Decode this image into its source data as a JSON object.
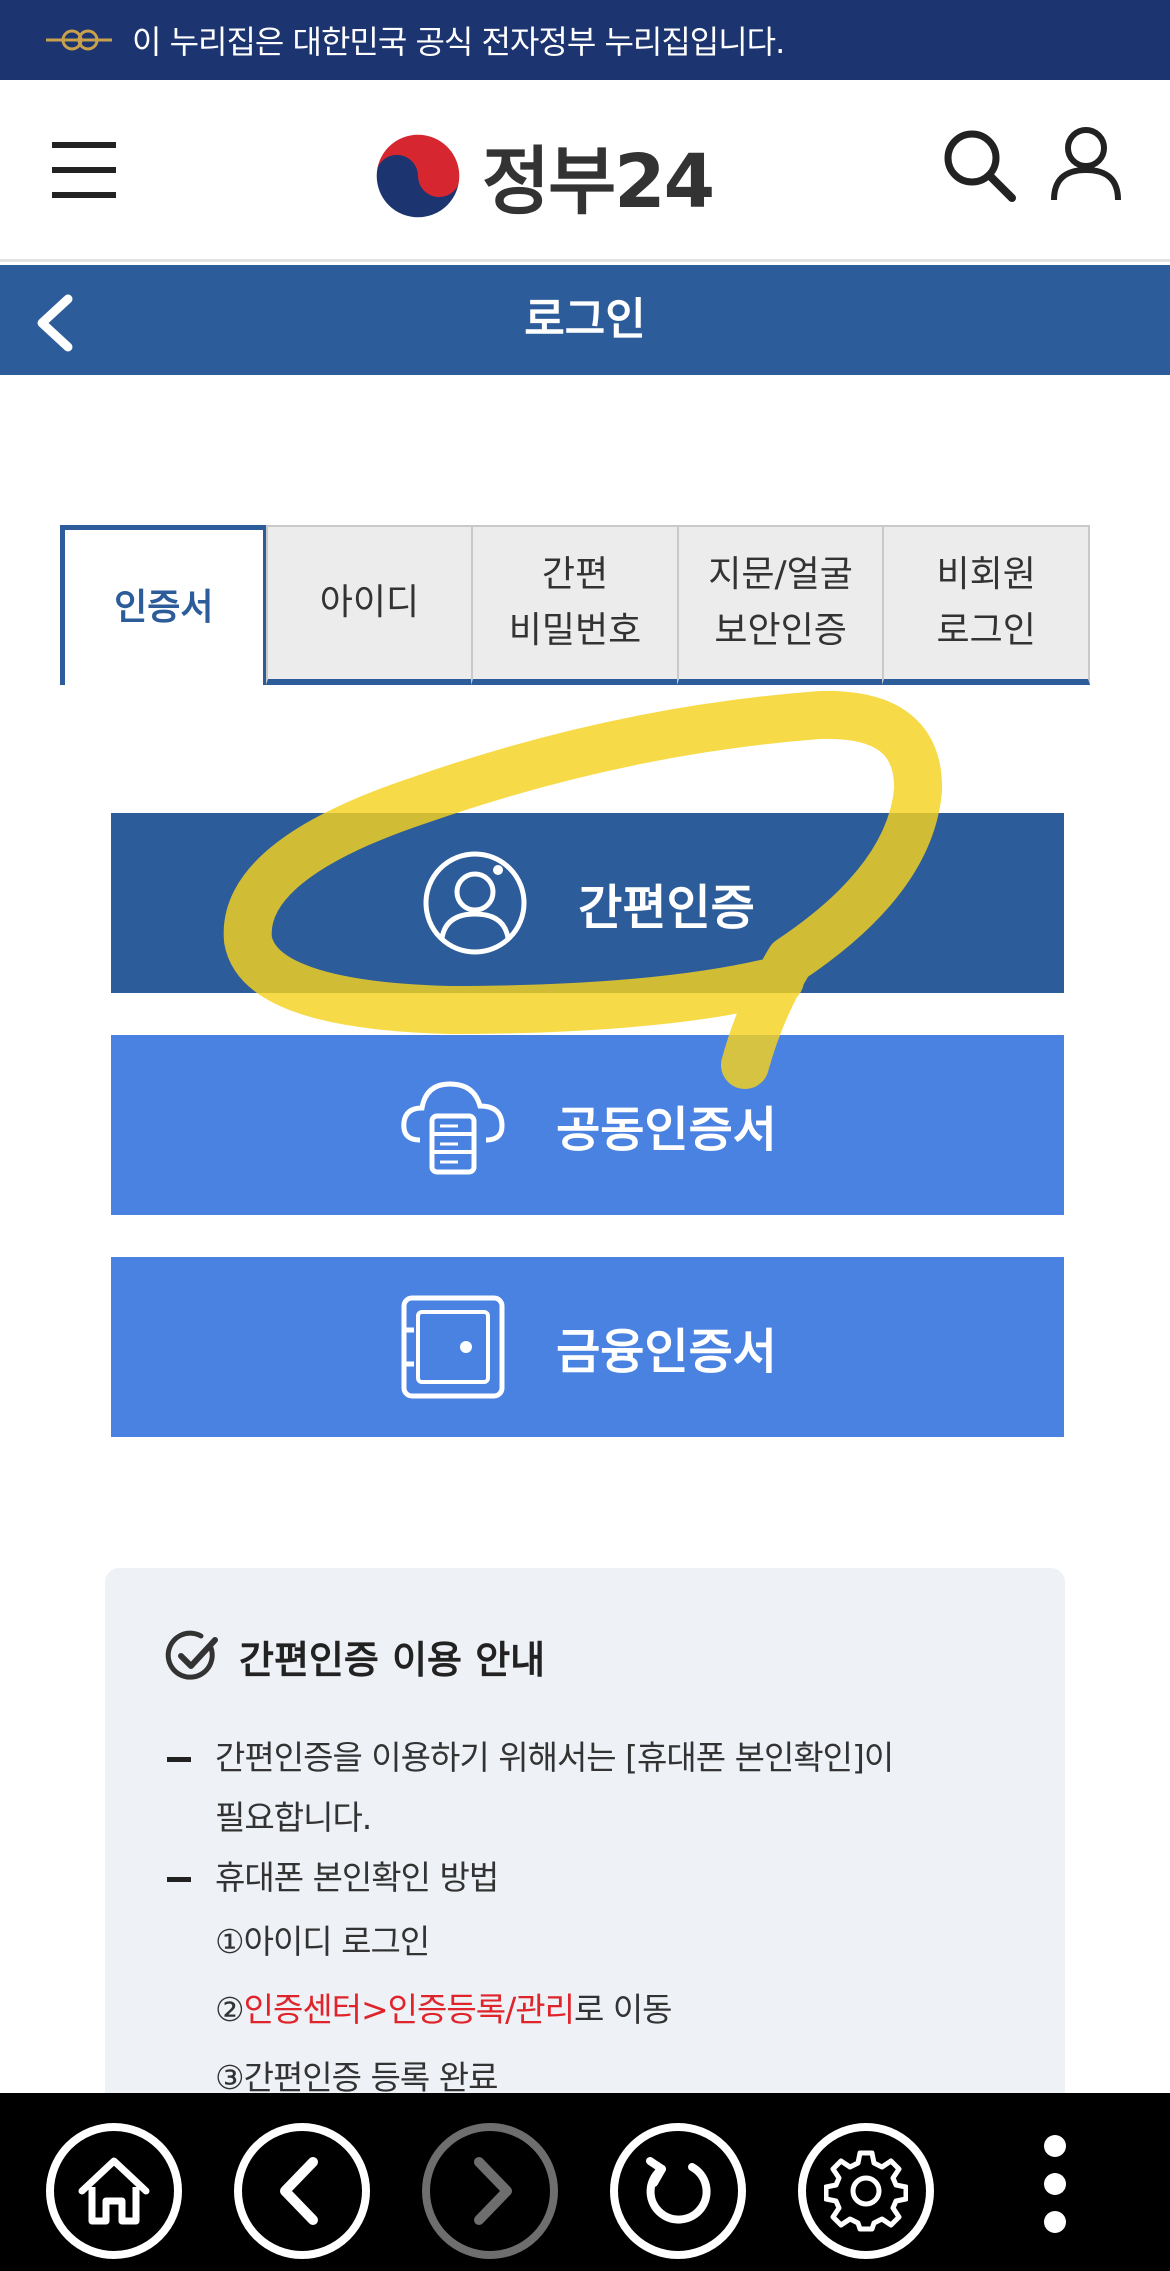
{
  "banner": {
    "text": "이 누리집은 대한민국 공식 전자정부 누리집입니다."
  },
  "header": {
    "logo_text": "정부24"
  },
  "titlebar": {
    "title": "로그인"
  },
  "tabs": [
    {
      "line1": "인증서",
      "line2": "",
      "active": true
    },
    {
      "line1": "아이디",
      "line2": "",
      "active": false
    },
    {
      "line1": "간편",
      "line2": "비밀번호",
      "active": false
    },
    {
      "line1": "지문/얼굴",
      "line2": "보안인증",
      "active": false
    },
    {
      "line1": "비회원",
      "line2": "로그인",
      "active": false
    }
  ],
  "auth_buttons": {
    "simple": "간편인증",
    "joint": "공동인증서",
    "finance": "금융인증서"
  },
  "info": {
    "title": "간편인증 이용 안내",
    "item1_line1": "간편인증을 이용하기 위해서는 [휴대폰 본인확인]이",
    "item1_line2": "필요합니다.",
    "item2": "휴대폰 본인확인 방법",
    "step1": "①아이디 로그인",
    "step2_num": "②",
    "step2_red": "인증센터>인증등록/관리",
    "step2_tail": "로 이동",
    "step3": "③간편인증 등록 완료"
  },
  "colors": {
    "banner": "#1c3570",
    "primary": "#2c5c9a",
    "secondary_button": "#4a82e2",
    "info_bg": "#eef1f6",
    "highlight": "#f5d21e",
    "link_red": "#e0242b"
  },
  "icons": {
    "menu": "hamburger-icon",
    "search": "search-icon",
    "user": "user-icon",
    "back": "chevron-left-icon",
    "simple": "person-circle-icon",
    "joint": "cloud-server-icon",
    "finance": "safe-icon",
    "check": "check-circle-icon",
    "home": "home-icon",
    "prev": "arrow-left-icon",
    "next": "arrow-right-icon",
    "refresh": "refresh-icon",
    "settings": "gear-icon",
    "more": "more-vertical-icon"
  }
}
